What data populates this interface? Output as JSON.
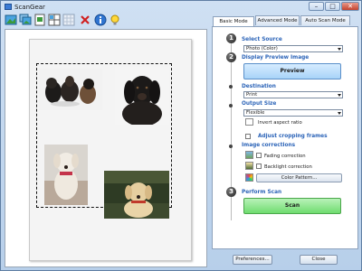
{
  "window": {
    "title": "ScanGear",
    "min_glyph": "–",
    "max_glyph": "□",
    "close_glyph": "✕"
  },
  "toolbar": {
    "buttons": [
      "scan-image-icon",
      "scan-multi-icon",
      "preview-icon",
      "grid-icon",
      "thumbnail-icon",
      "delete-icon",
      "info-icon",
      "help-bulb-icon"
    ]
  },
  "tabs": [
    {
      "label": "Basic Mode",
      "active": true
    },
    {
      "label": "Advanced Mode",
      "active": false
    },
    {
      "label": "Auto Scan Mode",
      "active": false
    }
  ],
  "steps": {
    "step1": {
      "number": "1",
      "title": "Select Source",
      "value": "Photo (Color)"
    },
    "step2": {
      "number": "2",
      "title": "Display Preview Image",
      "button": "Preview"
    },
    "destination": {
      "title": "Destination",
      "value": "Print"
    },
    "output_size": {
      "title": "Output Size",
      "value": "Flexible",
      "invert_label": "Invert aspect ratio"
    },
    "adjust_frames": {
      "label": "Adjust cropping frames"
    },
    "image_corrections": {
      "title": "Image corrections",
      "fading_label": "Fading correction",
      "backlight_label": "Backlight correction",
      "color_pattern_button": "Color Pattern..."
    },
    "step3": {
      "number": "3",
      "title": "Perform Scan",
      "button": "Scan"
    }
  },
  "footer": {
    "preferences": "Preferences...",
    "close": "Close"
  },
  "colors": {
    "accent": "#2c64b8",
    "preview_button": "#a8d3f8",
    "scan_button": "#6fdc6f"
  }
}
